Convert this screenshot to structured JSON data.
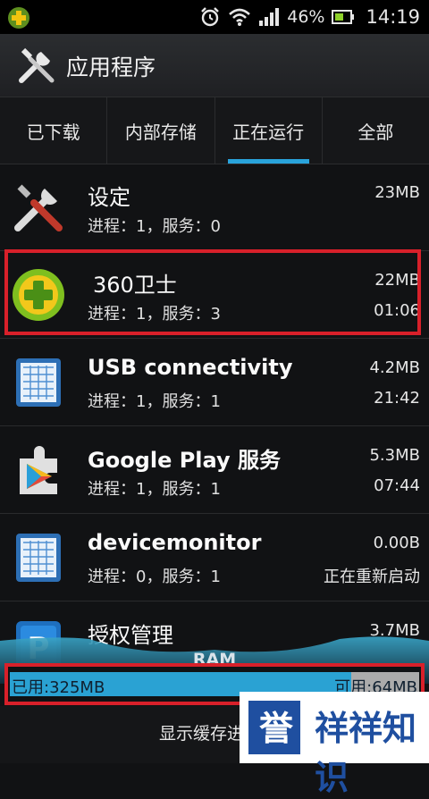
{
  "status_bar": {
    "battery_percent": "46%",
    "time": "14:19",
    "icons": [
      "app-notification-icon",
      "alarm-icon",
      "wifi-icon",
      "signal-icon",
      "battery-icon"
    ]
  },
  "header": {
    "title": "应用程序",
    "icon": "tools-icon"
  },
  "tabs": [
    {
      "label": "已下载",
      "active": false
    },
    {
      "label": "内部存储",
      "active": false
    },
    {
      "label": "正在运行",
      "active": true
    },
    {
      "label": "全部",
      "active": false
    }
  ],
  "apps": [
    {
      "name": "设定",
      "sub": "进程：1，服务：0",
      "size": "23MB",
      "status": "",
      "icon": "settings-tools-icon"
    },
    {
      "name": "360卫士",
      "sub": "进程：1，服务：3",
      "size": "22MB",
      "status": "01:06",
      "icon": "360-security-icon"
    },
    {
      "name": "USB connectivity",
      "sub": "进程：1，服务：1",
      "size": "4.2MB",
      "status": "21:42",
      "icon": "blueprint-app-icon"
    },
    {
      "name": "Google Play 服务",
      "sub": "进程：1，服务：1",
      "size": "5.3MB",
      "status": "07:44",
      "icon": "google-play-services-icon"
    },
    {
      "name": "devicemonitor",
      "sub": "进程：0，服务：1",
      "size": "0.00B",
      "status": "正在重新启动",
      "icon": "blueprint-app-icon"
    },
    {
      "name": "授权管理",
      "sub": "",
      "size": "3.7MB",
      "status": "",
      "icon": "license-manager-icon"
    }
  ],
  "ram": {
    "label": "RAM",
    "used": "已用:325MB",
    "free": "可用:64MB",
    "used_fraction": 0.835
  },
  "bottom": {
    "button": "显示缓存进"
  },
  "watermark": {
    "text": "誉祥祥知识"
  },
  "colors": {
    "accent": "#29a3db",
    "highlight": "#d8202a"
  }
}
